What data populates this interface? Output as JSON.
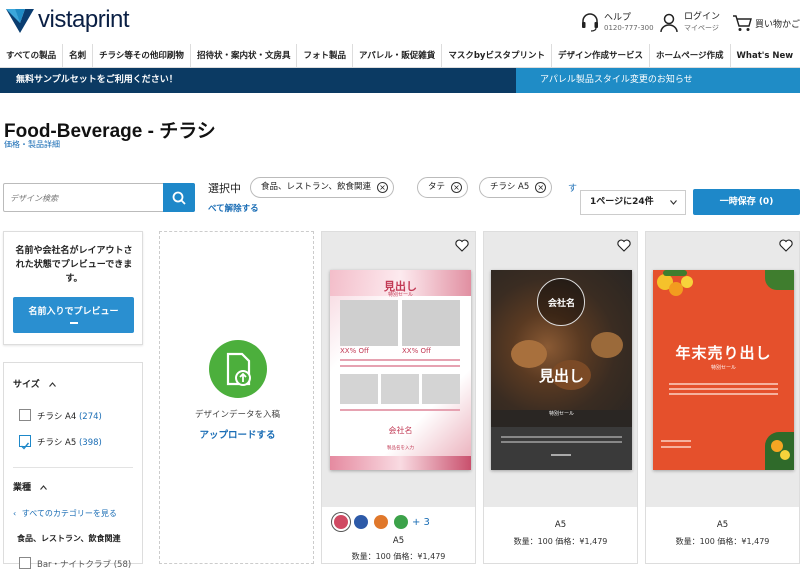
{
  "header": {
    "brand": "vistaprint",
    "help_label": "ヘルプ",
    "help_phone": "0120-777-300",
    "account_label": "ログイン",
    "account_sub": "マイページ",
    "cart_label": "買い物かご"
  },
  "nav": {
    "items": [
      "すべての製品",
      "名刺",
      "チラシ等その他印刷物",
      "招待状・案内状・文房具",
      "フォト製品",
      "アパレル・販促雑貨",
      "マスクbyビスタプリント",
      "デザイン作成サービス",
      "ホームページ作成",
      "What's New"
    ]
  },
  "banner": {
    "left": "無料サンプルセットをご利用ください！",
    "right": "アパレル製品スタイル変更のお知らせ"
  },
  "page": {
    "title": "Food-Beverage - チラシ",
    "price_link": "価格・製品詳細"
  },
  "search": {
    "placeholder": "デザイン検索"
  },
  "filters_bar": {
    "selected_label": "選択中",
    "chips": [
      "食品、レストラン、飲食関連",
      "タテ",
      "チラシ A5"
    ],
    "more": "す",
    "clear_all": "べて解除する",
    "per_page": "1ページに24件",
    "save": "一時保存 (0)"
  },
  "preview": {
    "text": "名前や会社名がレイアウトされた状態でプレビューできます。",
    "button": "名前入りでプレビュー"
  },
  "filters": {
    "size_heading": "サイズ",
    "sizes": [
      {
        "label": "チラシ A4",
        "count": "(274)",
        "checked": false
      },
      {
        "label": "チラシ A5",
        "count": "(398)",
        "checked": true
      }
    ],
    "industry_heading": "業種",
    "all_categories": "すべてのカテゴリーを見る",
    "industry_current": "食品、レストラン、飲食関連",
    "industry_partial": "Bar・ナイトクラブ (58)"
  },
  "upload": {
    "text": "デザインデータを入稿",
    "link": "アップロードする"
  },
  "products": [
    {
      "size": "A5",
      "price": "数量：100 価格：¥1,479",
      "swatches": [
        "#d04a63",
        "#2d5aa8",
        "#e0782b",
        "#3ca24a"
      ],
      "more_colors": "+ 3",
      "flyer_title": "見出し",
      "flyer_sub": "特別セール",
      "flyer_off": "XX% Off",
      "flyer_company": "会社名",
      "flyer_footer": "製品名を入力"
    },
    {
      "size": "A5",
      "price": "数量：100 価格：¥1,479",
      "flyer_company": "会社名",
      "flyer_title": "見出し",
      "flyer_sub": "特別セール"
    },
    {
      "size": "A5",
      "price": "数量：100 価格：¥1,479",
      "flyer_title": "年末売り出し",
      "flyer_sub": "特別セール"
    }
  ]
}
